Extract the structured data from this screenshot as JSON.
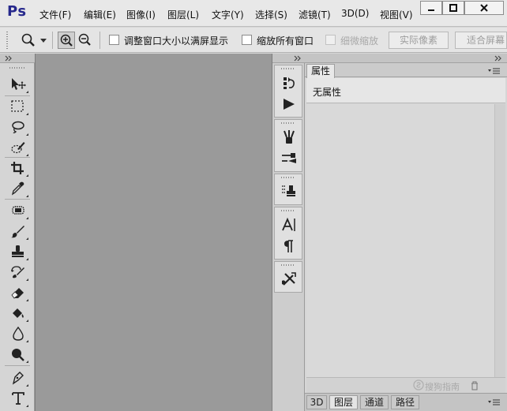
{
  "app": {
    "logo": "Ps",
    "menu": [
      "文件(F)",
      "编辑(E)",
      "图像(I)",
      "图层(L)",
      "文字(Y)",
      "选择(S)",
      "滤镜(T)",
      "3D(D)",
      "视图(V)"
    ]
  },
  "window_controls": [
    "minimize-icon",
    "maximize-icon",
    "close-icon"
  ],
  "options_bar": {
    "check_resize_windows": "调整窗口大小以满屏显示",
    "check_zoom_all": "缩放所有窗口",
    "check_scrubby_zoom": "细微缩放",
    "btn_actual_pixels": "实际像素",
    "btn_fit_screen": "适合屏幕"
  },
  "toolbox_tools": [
    "move-tool-icon",
    "marquee-tool-icon",
    "lasso-tool-icon",
    "quick-select-tool-icon",
    "crop-tool-icon",
    "eyedropper-tool-icon",
    "healing-brush-tool-icon",
    "brush-tool-icon",
    "clone-stamp-tool-icon",
    "history-brush-tool-icon",
    "eraser-tool-icon",
    "paint-bucket-tool-icon",
    "blur-tool-icon",
    "dodge-tool-icon",
    "pen-tool-icon",
    "type-tool-icon"
  ],
  "properties_panel": {
    "tab_label": "属性",
    "content_text": "无属性"
  },
  "bottom_tabs": [
    "3D",
    "图层",
    "通道",
    "路径"
  ],
  "watermark": "搜狗指南"
}
